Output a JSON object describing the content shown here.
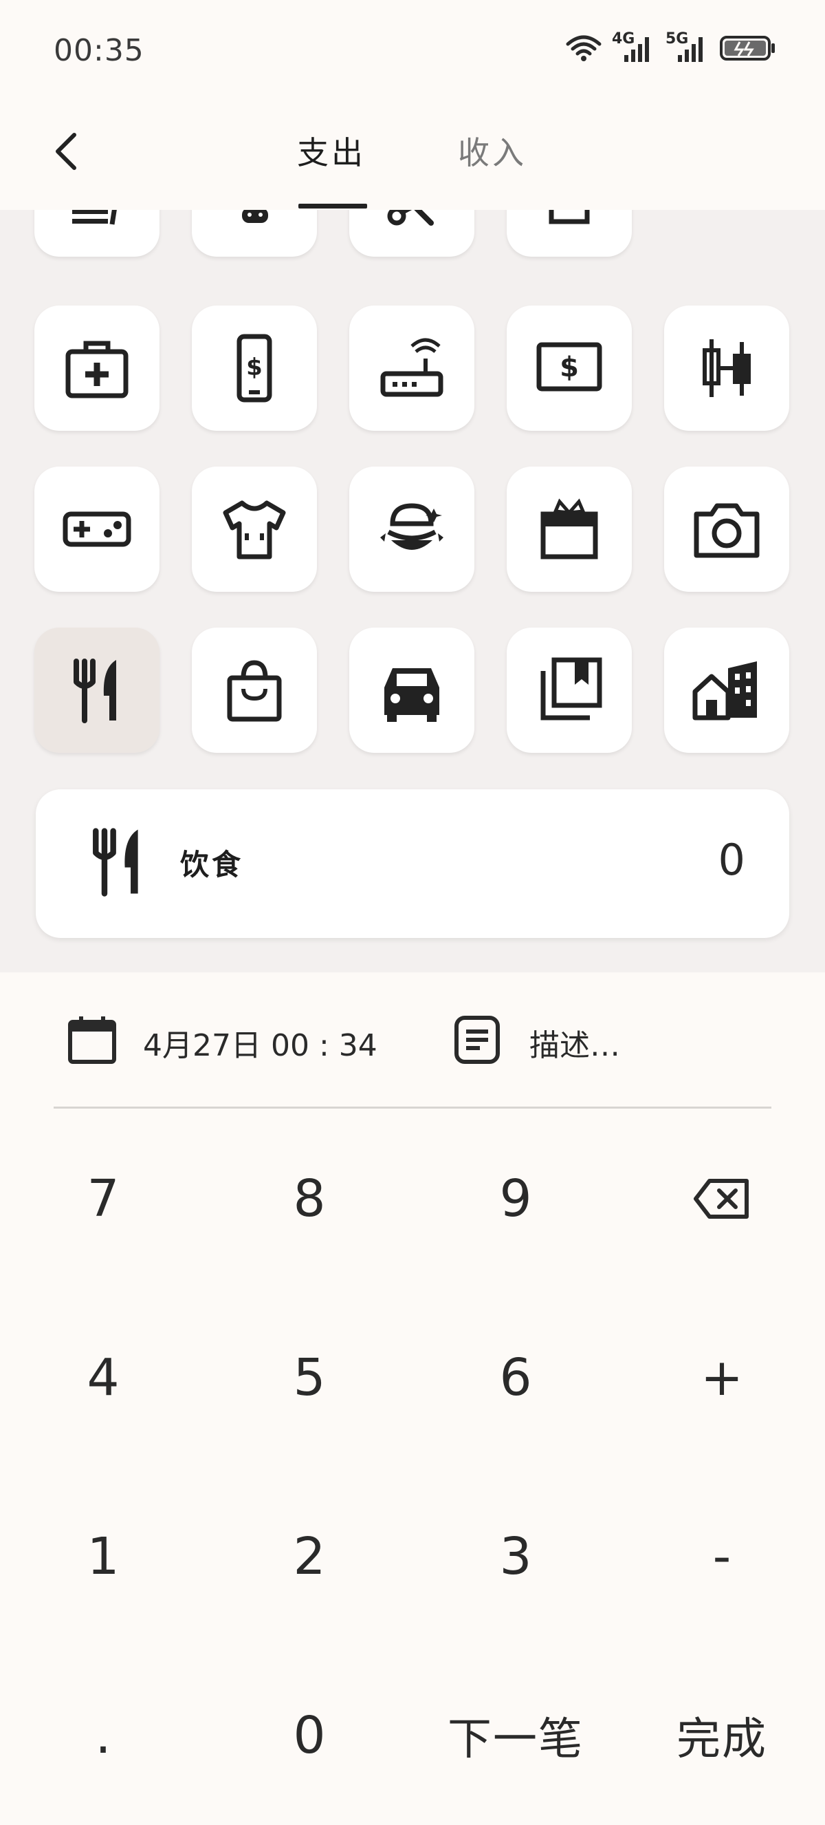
{
  "status_bar": {
    "time": "00:35",
    "network_1": "4G",
    "network_2": "5G",
    "icons": [
      "wifi-icon",
      "signal-4g-icon",
      "signal-5g-icon",
      "battery-charging-icon"
    ]
  },
  "header": {
    "tabs": [
      {
        "label": "支出",
        "active": true
      },
      {
        "label": "收入",
        "active": false
      }
    ]
  },
  "categories": {
    "partial_row_icons": [
      "receipt-icon",
      "pet-icon",
      "scissors-icon",
      "box-icon"
    ],
    "rows": [
      [
        "medical-kit-icon",
        "phone-bill-icon",
        "router-icon",
        "cash-icon",
        "stocks-icon"
      ],
      [
        "gamepad-icon",
        "clothes-icon",
        "hamburger-icon",
        "gift-icon",
        "camera-icon"
      ],
      [
        "utensils-icon",
        "shopping-bag-icon",
        "car-icon",
        "books-icon",
        "housing-icon"
      ]
    ],
    "selected": "utensils-icon"
  },
  "summary": {
    "category_label": "饮食",
    "amount": "0",
    "icon": "utensils-icon"
  },
  "meta": {
    "date": "4月27日 00 : 34",
    "description_placeholder": "描述…"
  },
  "keypad": {
    "keys": [
      [
        "7",
        "8",
        "9",
        "backspace"
      ],
      [
        "4",
        "5",
        "6",
        "+"
      ],
      [
        "1",
        "2",
        "3",
        "-"
      ],
      [
        ".",
        "0",
        "下一笔",
        "完成"
      ]
    ]
  },
  "colors": {
    "background": "#fdfaf7",
    "grid_background": "#f3f0ef",
    "selected_tile": "#ece6e2",
    "text": "#1e1e1e",
    "muted_text": "#7a7a7a"
  }
}
